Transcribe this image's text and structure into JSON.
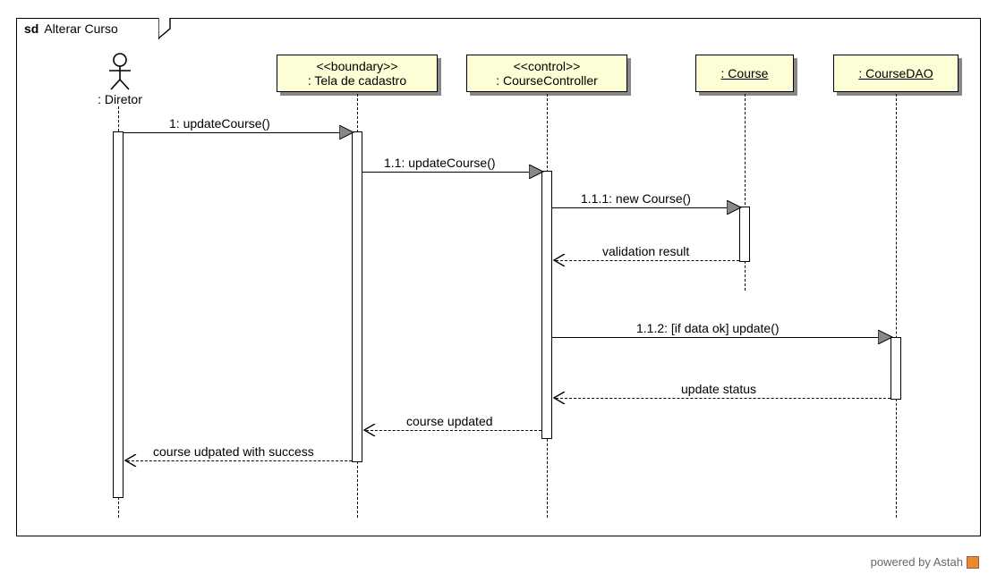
{
  "frame": {
    "tag": "sd",
    "title": "Alterar Curso"
  },
  "actor": {
    "label": ": Diretor"
  },
  "lifelines": {
    "boundary": {
      "stereotype": "<<boundary>>",
      "name": ": Tela de cadastro"
    },
    "control": {
      "stereotype": "<<control>>",
      "name": ": CourseController"
    },
    "course": {
      "name": ": Course"
    },
    "dao": {
      "name": ": CourseDAO"
    }
  },
  "messages": {
    "m1": "1: updateCourse()",
    "m11": "1.1: updateCourse()",
    "m111": "1.1.1: new Course()",
    "r111": "validation result",
    "m112": "1.1.2: [if data ok] update()",
    "r112": "update status",
    "r11": "course updated",
    "r1": "course udpated with success"
  },
  "footer": "powered by Astah",
  "chart_data": {
    "type": "sequence-diagram",
    "frame": "sd Alterar Curso",
    "participants": [
      {
        "id": "diretor",
        "name": ": Diretor",
        "kind": "actor"
      },
      {
        "id": "tela",
        "name": ": Tela de cadastro",
        "stereotype": "boundary"
      },
      {
        "id": "ctrl",
        "name": ": CourseController",
        "stereotype": "control"
      },
      {
        "id": "course",
        "name": ": Course"
      },
      {
        "id": "dao",
        "name": ": CourseDAO"
      }
    ],
    "messages": [
      {
        "seq": "1",
        "from": "diretor",
        "to": "tela",
        "label": "updateCourse()",
        "type": "sync"
      },
      {
        "seq": "1.1",
        "from": "tela",
        "to": "ctrl",
        "label": "updateCourse()",
        "type": "sync"
      },
      {
        "seq": "1.1.1",
        "from": "ctrl",
        "to": "course",
        "label": "new Course()",
        "type": "sync"
      },
      {
        "seq": "",
        "from": "course",
        "to": "ctrl",
        "label": "validation result",
        "type": "return"
      },
      {
        "seq": "1.1.2",
        "from": "ctrl",
        "to": "dao",
        "label": "[if data ok] update()",
        "type": "sync"
      },
      {
        "seq": "",
        "from": "dao",
        "to": "ctrl",
        "label": "update status",
        "type": "return"
      },
      {
        "seq": "",
        "from": "ctrl",
        "to": "tela",
        "label": "course updated",
        "type": "return"
      },
      {
        "seq": "",
        "from": "tela",
        "to": "diretor",
        "label": "course udpated with success",
        "type": "return"
      }
    ]
  }
}
